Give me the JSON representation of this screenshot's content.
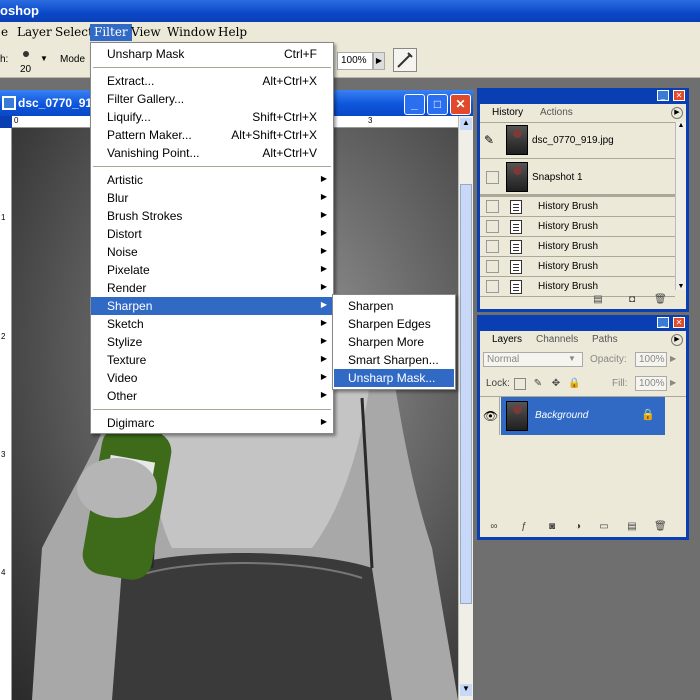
{
  "app": {
    "title_fragment": "oshop"
  },
  "menubar": {
    "items": [
      {
        "label": "e"
      },
      {
        "label": "Layer"
      },
      {
        "label": "Select"
      },
      {
        "label": "Filter"
      },
      {
        "label": "View"
      },
      {
        "label": "Window"
      },
      {
        "label": "Help"
      }
    ]
  },
  "options": {
    "brush_label": "h:",
    "brush_size": "20",
    "mode_label": "Mode",
    "zoom_value": "100%"
  },
  "document": {
    "title": "dsc_0770_91",
    "ruler_top": [
      "0",
      "3"
    ],
    "ruler_left": [
      "1",
      "2",
      "3",
      "4"
    ]
  },
  "filter_menu": {
    "last_filter": {
      "label": "Unsharp Mask",
      "shortcut": "Ctrl+F"
    },
    "group1": [
      {
        "label": "Extract...",
        "shortcut": "Alt+Ctrl+X"
      },
      {
        "label": "Filter Gallery...",
        "shortcut": ""
      },
      {
        "label": "Liquify...",
        "shortcut": "Shift+Ctrl+X"
      },
      {
        "label": "Pattern Maker...",
        "shortcut": "Alt+Shift+Ctrl+X"
      },
      {
        "label": "Vanishing Point...",
        "shortcut": "Alt+Ctrl+V"
      }
    ],
    "group2": [
      {
        "label": "Artistic"
      },
      {
        "label": "Blur"
      },
      {
        "label": "Brush Strokes"
      },
      {
        "label": "Distort"
      },
      {
        "label": "Noise"
      },
      {
        "label": "Pixelate"
      },
      {
        "label": "Render"
      },
      {
        "label": "Sharpen"
      },
      {
        "label": "Sketch"
      },
      {
        "label": "Stylize"
      },
      {
        "label": "Texture"
      },
      {
        "label": "Video"
      },
      {
        "label": "Other"
      }
    ],
    "group3": [
      {
        "label": "Digimarc"
      }
    ],
    "highlighted": "Sharpen"
  },
  "sharpen_submenu": {
    "items": [
      {
        "label": "Sharpen"
      },
      {
        "label": "Sharpen Edges"
      },
      {
        "label": "Sharpen More"
      },
      {
        "label": "Smart Sharpen..."
      },
      {
        "label": "Unsharp Mask..."
      }
    ],
    "highlighted": "Unsharp Mask..."
  },
  "history_panel": {
    "tabs": [
      {
        "label": "History"
      },
      {
        "label": "Actions"
      }
    ],
    "snapshots": [
      {
        "label": "dsc_0770_919.jpg"
      },
      {
        "label": "Snapshot 1"
      }
    ],
    "states": [
      {
        "label": "History Brush"
      },
      {
        "label": "History Brush"
      },
      {
        "label": "History Brush"
      },
      {
        "label": "History Brush"
      },
      {
        "label": "History Brush"
      }
    ]
  },
  "layers_panel": {
    "tabs": [
      {
        "label": "Layers"
      },
      {
        "label": "Channels"
      },
      {
        "label": "Paths"
      }
    ],
    "blend_mode": "Normal",
    "opacity_label": "Opacity:",
    "opacity_value": "100%",
    "lock_label": "Lock:",
    "fill_label": "Fill:",
    "fill_value": "100%",
    "layers": [
      {
        "label": "Background",
        "selected": true
      }
    ]
  },
  "colors": {
    "xp_blue": "#0a3fb4",
    "highlight": "#316ac5",
    "panel_bg": "#ece9d8"
  }
}
